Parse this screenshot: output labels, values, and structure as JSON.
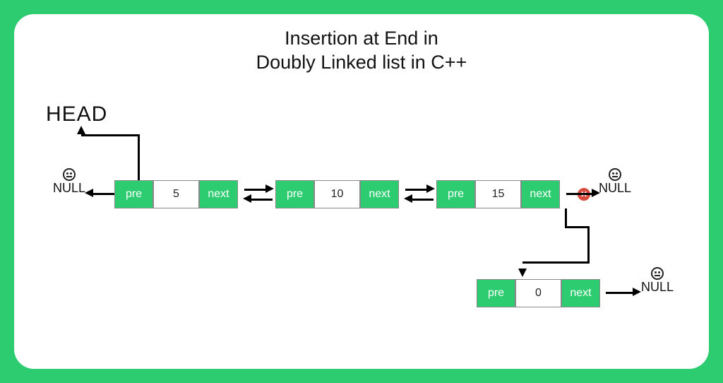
{
  "title_line1": "Insertion at End in",
  "title_line2": "Doubly Linked list in C++",
  "head_label": "HEAD",
  "null_label": "NULL",
  "ptr_prev": "pre",
  "ptr_next": "next",
  "cross_icon": "✕",
  "diagram": {
    "description": "Doubly linked list with three nodes (5, 10, 15). HEAD points to first node. First node's prev → NULL. Node 15's next originally pointed to NULL (marked with red cross). A new node (value 0) is inserted at the end: node 15's next now points down to new node, new node's next → NULL.",
    "nodes": [
      {
        "value": 5,
        "prev": "NULL",
        "next": "node-10"
      },
      {
        "value": 10,
        "prev": "node-5",
        "next": "node-15"
      },
      {
        "value": 15,
        "prev": "node-10",
        "next_old": "NULL",
        "next_new": "node-0"
      },
      {
        "value": 0,
        "prev": "node-15",
        "next": "NULL",
        "is_new": true
      }
    ]
  },
  "colors": {
    "accent": "#2ECC71",
    "cross": "#D84A3E",
    "text": "#111"
  }
}
